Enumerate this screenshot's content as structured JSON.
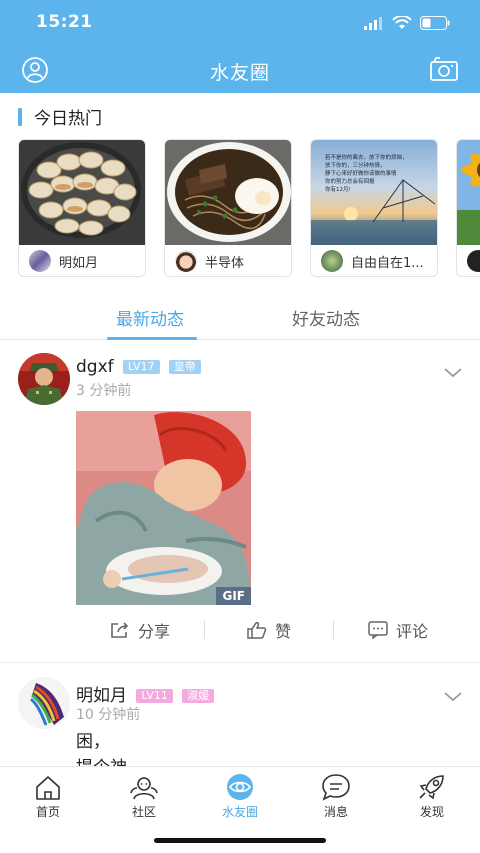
{
  "status": {
    "time": "15:21"
  },
  "nav": {
    "title": "水友圈"
  },
  "hot": {
    "title": "今日热门",
    "cards": [
      {
        "author": "明如月"
      },
      {
        "author": "半导体"
      },
      {
        "author": "自由自在1...",
        "image_text": [
          "若不是你的离去，放下你的烦恼，",
          "放下你的，三分钟热情，",
          "静下心来好好做你该做的事情",
          "你的努力总会有回报",
          "你有12月!"
        ]
      },
      {
        "author": ""
      }
    ]
  },
  "tabs": [
    {
      "label": "最新动态"
    },
    {
      "label": "好友动态"
    }
  ],
  "posts": [
    {
      "name": "dgxf",
      "level": "LV17",
      "title": "皇帝",
      "time": "3 分钟前",
      "gif_label": "GIF",
      "actions": {
        "share": "分享",
        "like": "赞",
        "comment": "评论"
      }
    },
    {
      "name": "明如月",
      "level": "LV11",
      "title": "淑媛",
      "time": "10 分钟前",
      "text_line1": "困，",
      "text_line2": "提个神"
    }
  ],
  "bottom_tabs": [
    {
      "label": "首页"
    },
    {
      "label": "社区"
    },
    {
      "label": "水友圈"
    },
    {
      "label": "消息"
    },
    {
      "label": "发现"
    }
  ],
  "colors": {
    "primary": "#5bb4ec",
    "active_text": "#4ba8e4",
    "level_badge": "#9fd2f5",
    "title_badge": "#f5a9e0"
  }
}
